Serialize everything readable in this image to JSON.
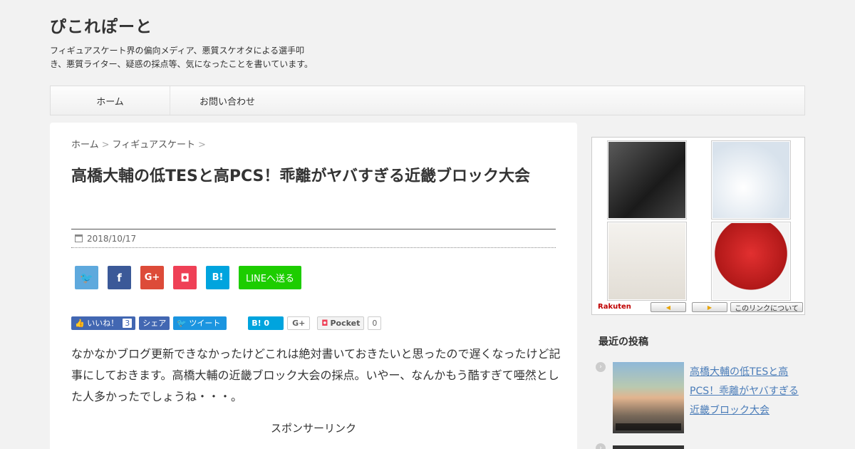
{
  "site": {
    "title": "ぴこれぽーと",
    "description": "フィギュアスケート界の偏向メディア、悪質スケオタによる選手叩き、悪質ライター、疑惑の採点等、気になったことを書いています。"
  },
  "nav": {
    "items": [
      "ホーム",
      "お問い合わせ"
    ]
  },
  "breadcrumb": {
    "items": [
      "ホーム",
      "フィギュアスケート"
    ],
    "separator": ">"
  },
  "post": {
    "title": "高橋大輔の低TESと高PCS！乖離がヤバすぎる近畿ブロック大会",
    "date": "2018/10/17",
    "body": "なかなかブログ更新できなかったけどこれは絶対書いておきたいと思ったので遅くなったけど記事にしておきます。高橋大輔の近畿ブロック大会の採点。いやー、なんかもう酷すぎて唖然とした人多かったでしょうね・・・。",
    "sponsor_label": "スポンサーリンク"
  },
  "share_buttons": {
    "twitter": "🐦",
    "facebook": "f",
    "googleplus": "G+",
    "pocket": "◘",
    "hatena": "B!",
    "line": "LINEへ送る"
  },
  "social_counts": {
    "like_label": "👍 いいね！",
    "like_count": "3",
    "share_label": "シェア",
    "tweet_label": "🐦 ツイート",
    "hatena_label": "B! 0",
    "gplus_label": "G+",
    "pocket_label": "Pocket",
    "pocket_count": "0"
  },
  "ad": {
    "brand": "Rakuten",
    "prev": "◀",
    "next": "▶",
    "about": "このリンクについて"
  },
  "sidebar": {
    "recent_heading": "最近の投稿",
    "recent_posts": [
      {
        "title": "高橋大輔の低TESと高PCS！乖離がヤバすぎる近畿ブロック大会"
      }
    ]
  },
  "colors": {
    "twitter": "#5ea9dd",
    "facebook": "#3b5998",
    "googleplus": "#dd4b39",
    "pocket": "#ef4056",
    "hatena": "#00a4de",
    "line": "#1dcd00",
    "link": "#4a7cb8"
  }
}
